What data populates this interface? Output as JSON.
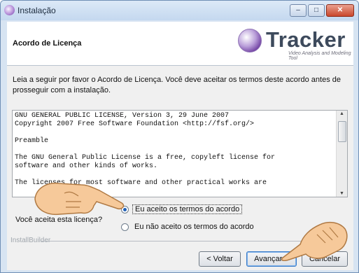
{
  "window": {
    "title": "Instalação"
  },
  "header": {
    "section_title": "Acordo de Licença",
    "logo_text": "Tracker",
    "logo_subtitle": "Video Analysis and Modeling Tool"
  },
  "intro_text": "Leia a seguir por favor o Acordo de Licença. Você deve aceitar os termos deste acordo antes de prosseguir com a instalação.",
  "license": {
    "lines": [
      "GNU GENERAL PUBLIC LICENSE, Version 3, 29 June 2007",
      "Copyright 2007 Free Software Foundation <http://fsf.org/>",
      "",
      "Preamble",
      "",
      "The GNU General Public License is a free, copyleft license for",
      "software and other kinds of works.",
      "",
      "The licenses for most software and other practical works are"
    ]
  },
  "agreement": {
    "question": "Você aceita esta licença?",
    "options": [
      {
        "label": "Eu aceito os termos do acordo",
        "selected": true
      },
      {
        "label": "Eu não aceito os termos do acordo",
        "selected": false
      }
    ]
  },
  "footer": {
    "group_label": "InstallBuilder"
  },
  "buttons": {
    "back": "< Voltar",
    "next": "Avançar >",
    "cancel": "Cancelar"
  },
  "colors": {
    "accent": "#3b7cc9",
    "titlebar": "#c4d8ef",
    "hand": "#f6c99a"
  }
}
